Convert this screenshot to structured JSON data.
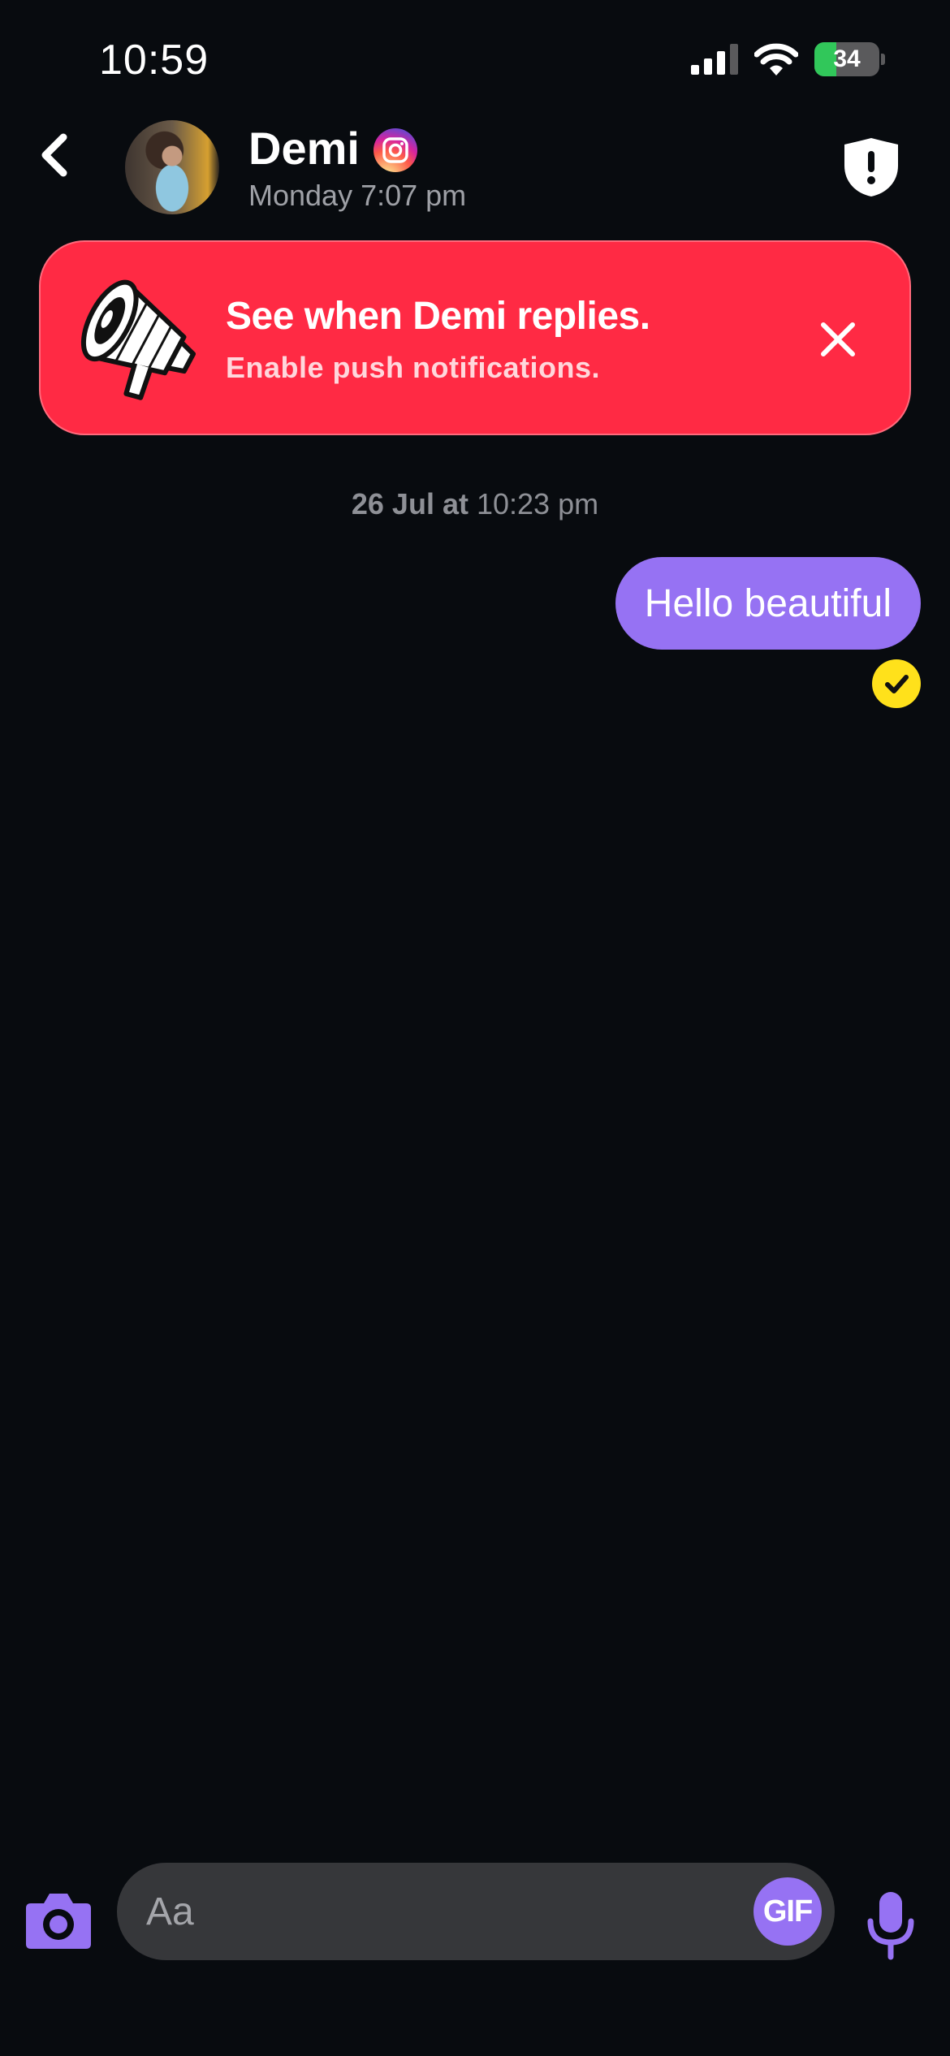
{
  "status_bar": {
    "time": "10:59",
    "battery_percent": 34,
    "battery_label": "34"
  },
  "header": {
    "contact_name": "Demi",
    "last_seen": "Monday 7:07 pm"
  },
  "banner": {
    "title": "See when Demi replies.",
    "subtitle": "Enable push notifications."
  },
  "conversation": {
    "date_separator": {
      "date": "26 Jul at",
      "time": "10:23 pm"
    },
    "messages": [
      {
        "text": "Hello beautiful",
        "direction": "outgoing",
        "status": "read"
      }
    ]
  },
  "composer": {
    "placeholder": "Aa",
    "gif_label": "GIF"
  },
  "colors": {
    "background": "#080b0f",
    "accent": "#9672f3",
    "banner": "#ff2a44",
    "read_check": "#ffe11b"
  }
}
